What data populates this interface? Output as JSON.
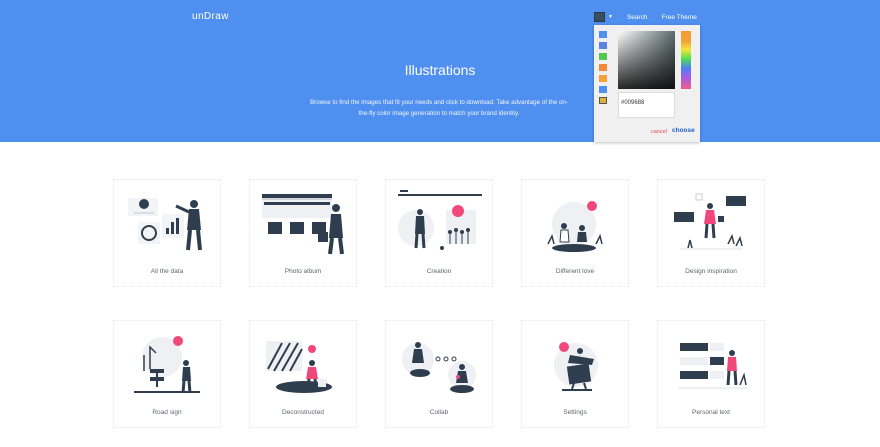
{
  "brand": {
    "name": "unDraw"
  },
  "nav": {
    "search": "Search",
    "theme": "Free Theme"
  },
  "hero": {
    "title": "Illustrations",
    "description": "Browse to find the images that fit your needs and click to download. Take advantage of the on-the-fly color image generation to match your brand identity."
  },
  "picker": {
    "hex": "#009688",
    "cancel": "cancel",
    "choose": "choose",
    "swatches": [
      "#4f8ff0",
      "#5d7fe8",
      "#4fc94f",
      "#f28a3a",
      "#f5a13a",
      "#4f8ff0",
      "#d9b33a"
    ]
  },
  "colors": {
    "accent": "#f0487a",
    "dark": "#2f3e4e",
    "header": "#4f8ff0"
  },
  "cards": [
    {
      "label": "All the data",
      "icon": "data-charts-icon"
    },
    {
      "label": "Photo album",
      "icon": "photo-album-icon"
    },
    {
      "label": "Creation",
      "icon": "creation-icon"
    },
    {
      "label": "Different love",
      "icon": "different-love-icon"
    },
    {
      "label": "Design inspiration",
      "icon": "design-inspiration-icon"
    },
    {
      "label": "Road sign",
      "icon": "road-sign-icon"
    },
    {
      "label": "Deconstructed",
      "icon": "deconstructed-icon"
    },
    {
      "label": "Collab",
      "icon": "collab-icon"
    },
    {
      "label": "Settings",
      "icon": "settings-icon"
    },
    {
      "label": "Personal text",
      "icon": "personal-text-icon"
    }
  ]
}
